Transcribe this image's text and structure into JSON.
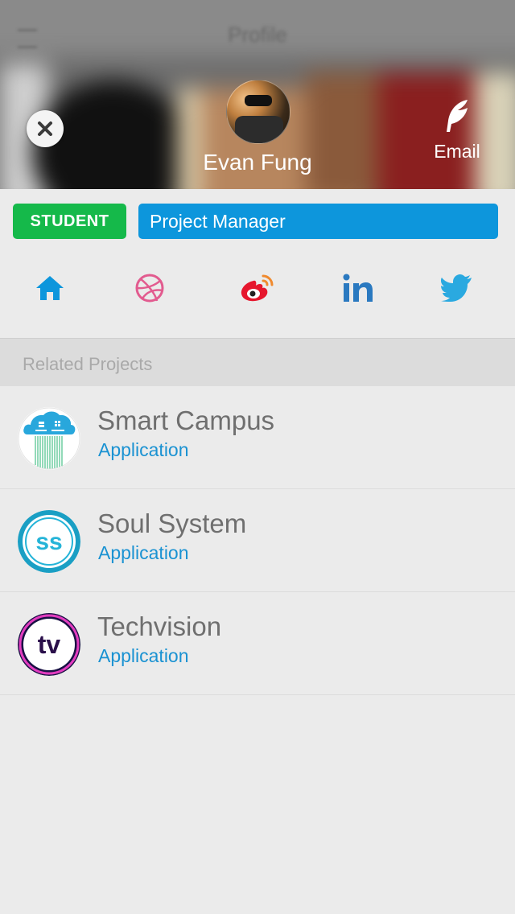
{
  "profile": {
    "name": "Evan Fung",
    "email_label": "Email",
    "role_tag": "STUDENT",
    "position": "Project Manager"
  },
  "header_bg": {
    "title": "Profile"
  },
  "social": [
    {
      "icon": "home-icon",
      "color": "#0d96dc"
    },
    {
      "icon": "dribbble-icon",
      "color": "#e25b8f"
    },
    {
      "icon": "weibo-icon",
      "color": "#e6162d"
    },
    {
      "icon": "linkedin-icon",
      "color": "#2a79c0"
    },
    {
      "icon": "twitter-icon",
      "color": "#2aa9e0"
    }
  ],
  "related": {
    "heading": "Related Projects",
    "items": [
      {
        "title": "Smart Campus",
        "subtitle": "Application",
        "icon": "smart-campus-icon"
      },
      {
        "title": "Soul System",
        "subtitle": "Application",
        "icon": "soul-system-icon"
      },
      {
        "title": "Techvision",
        "subtitle": "Application",
        "icon": "techvision-icon"
      }
    ]
  },
  "colors": {
    "student_tag": "#15b94a",
    "role_tag": "#0d96dc",
    "link_blue": "#1a92d2"
  }
}
